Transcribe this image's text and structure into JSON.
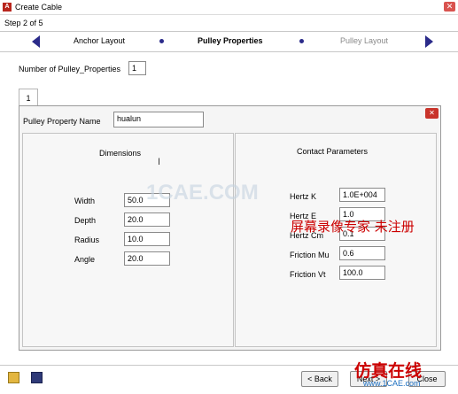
{
  "window": {
    "title": "Create Cable",
    "app_icon": "A"
  },
  "step_text": "Step 2 of 5",
  "nav": {
    "steps": [
      "Anchor Layout",
      "Pulley Properties",
      "Pulley Layout"
    ],
    "active_index": 1
  },
  "num_pulley": {
    "label": "Number of Pulley_Properties",
    "value": "1"
  },
  "tab_label": "1",
  "pulley_name": {
    "label": "Pulley Property Name",
    "value": "hualun"
  },
  "dimensions": {
    "title": "Dimensions",
    "fields": [
      {
        "label": "Width",
        "value": "50.0"
      },
      {
        "label": "Depth",
        "value": "20.0"
      },
      {
        "label": "Radius",
        "value": "10.0"
      },
      {
        "label": "Angle",
        "value": "20.0"
      }
    ]
  },
  "contact": {
    "title": "Contact Parameters",
    "fields": [
      {
        "label": "Hertz K",
        "value": "1.0E+004"
      },
      {
        "label": "Hertz E",
        "value": "1.0"
      },
      {
        "label": "Hertz Cm",
        "value": "0.1"
      },
      {
        "label": "Friction Mu",
        "value": "0.6"
      },
      {
        "label": "Friction Vt",
        "value": "100.0"
      }
    ]
  },
  "buttons": {
    "back": "< Back",
    "next": "Next >",
    "close": "Close"
  },
  "watermarks": {
    "center": "1CAE.COM",
    "recorder": "屏幕录像专家 未注册",
    "footer_cn": "仿真在线",
    "footer_url": "www.1CAE.com"
  },
  "colors": {
    "nav_arrow": "#2b2b8a",
    "close_red": "#c9342b",
    "watermark_red": "#cc0000"
  }
}
